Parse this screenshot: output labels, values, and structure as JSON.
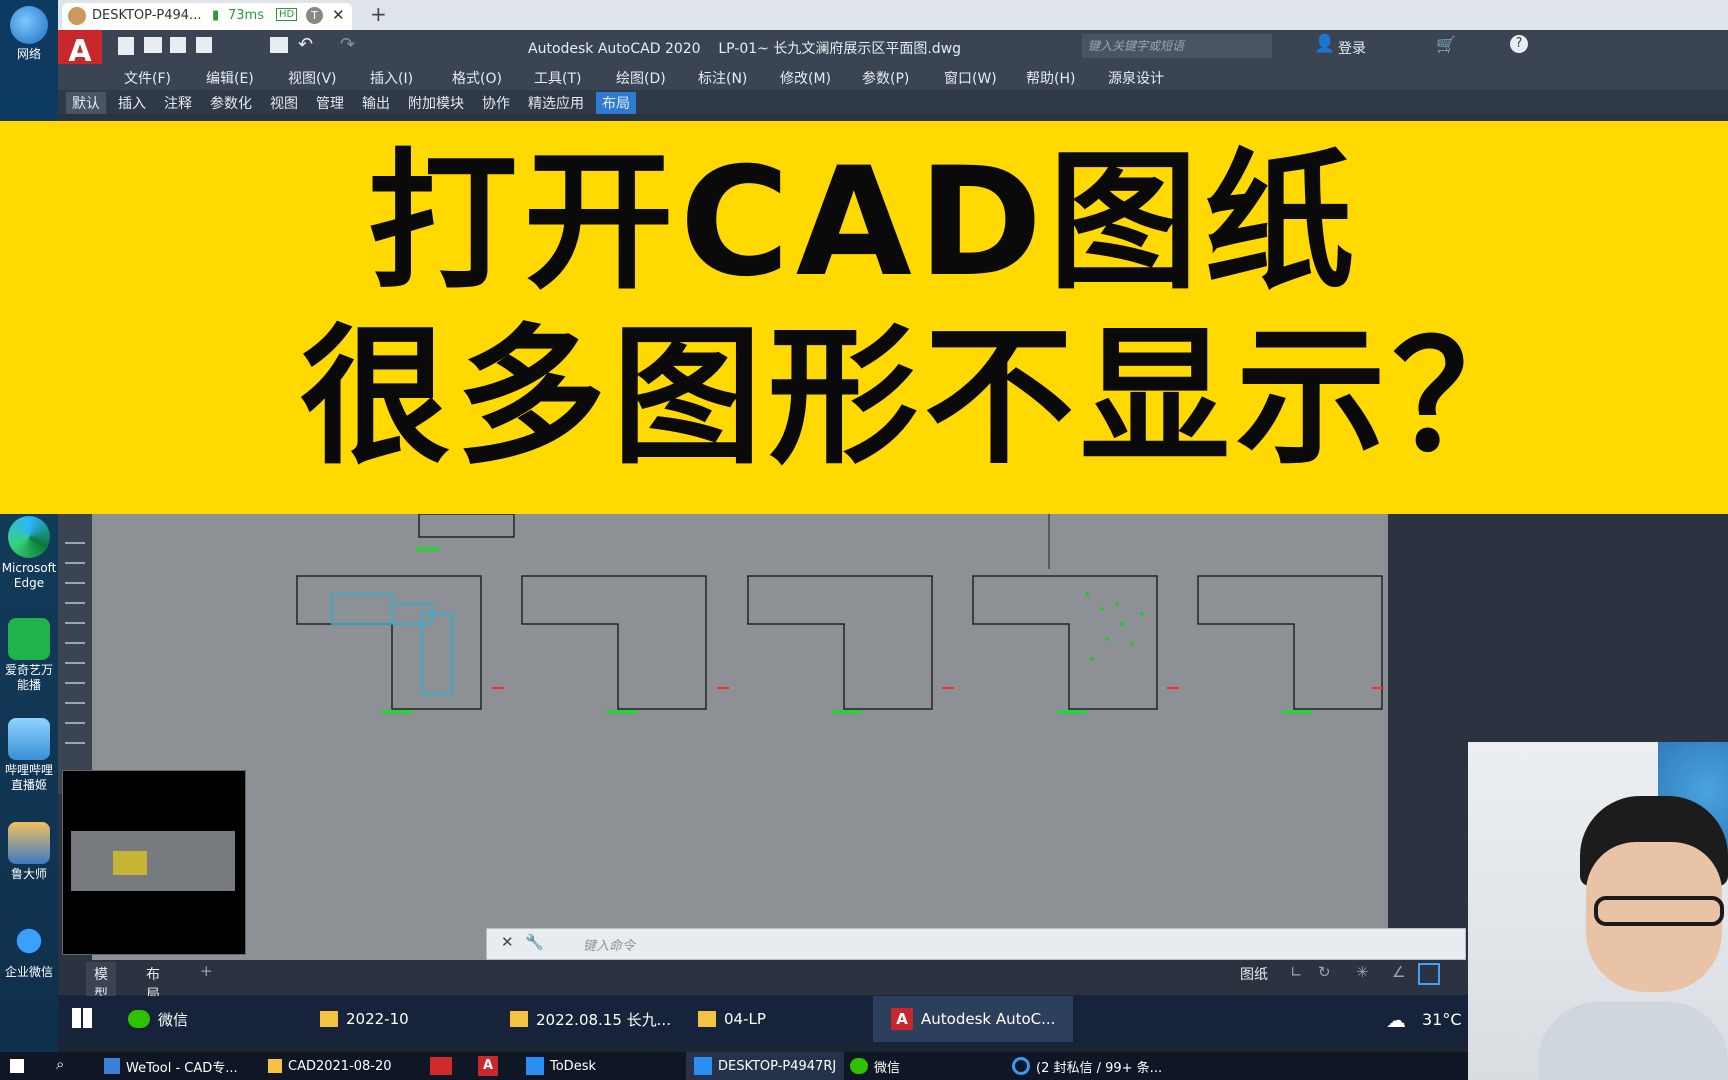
{
  "desktop": {
    "icons": [
      {
        "label": "网络",
        "icon": "network-icon"
      },
      {
        "label": "Microsoft Edge",
        "icon": "edge-icon"
      },
      {
        "label": "爱奇艺万能播",
        "icon": "iqiyi-icon"
      },
      {
        "label": "哔哩哔哩直播姬",
        "icon": "bilibili-icon"
      },
      {
        "label": "鲁大师",
        "icon": "ludashi-icon"
      },
      {
        "label": "企业微信",
        "icon": "wecom-icon"
      }
    ]
  },
  "remote_tab": {
    "title": "DESKTOP-P494...",
    "latency": "73ms",
    "hd_badge": "HD",
    "t_badge": "T",
    "new_tab": "+"
  },
  "acad": {
    "window_title": "Autodesk AutoCAD 2020    LP-01~ 长九文澜府展示区平面图.dwg",
    "search_placeholder": "键入关键字或短语",
    "login": "登录",
    "menu": [
      "文件(F)",
      "编辑(E)",
      "视图(V)",
      "插入(I)",
      "格式(O)",
      "工具(T)",
      "绘图(D)",
      "标注(N)",
      "修改(M)",
      "参数(P)",
      "窗口(W)",
      "帮助(H)",
      "源泉设计"
    ],
    "ribbon_tabs": [
      "默认",
      "插入",
      "注释",
      "参数化",
      "视图",
      "管理",
      "输出",
      "附加模块",
      "协作",
      "精选应用",
      "布局"
    ],
    "active_ribbon_tab": "布局",
    "command_placeholder": "键入命令",
    "layout_tabs": [
      "模型",
      "布局",
      "+"
    ],
    "status_mode": "图纸"
  },
  "banner": {
    "line1": "打开CAD图纸",
    "line2": "很多图形不显示？"
  },
  "taskbar_main": {
    "items": [
      "微信",
      "2022-10",
      "2022.08.15 长九...",
      "04-LP",
      "Autodesk AutoC..."
    ],
    "weather": "31°C"
  },
  "taskbar_host": {
    "items": [
      "WeTool - CAD专...",
      "CAD2021-08-20",
      "ToDesk",
      "DESKTOP-P4947RJ",
      "微信",
      "(2 封私信 / 99+ 条..."
    ]
  },
  "colors": {
    "banner": "#ffd900",
    "canvas": "#8d9196",
    "active_tab": "#2e7bd4"
  }
}
